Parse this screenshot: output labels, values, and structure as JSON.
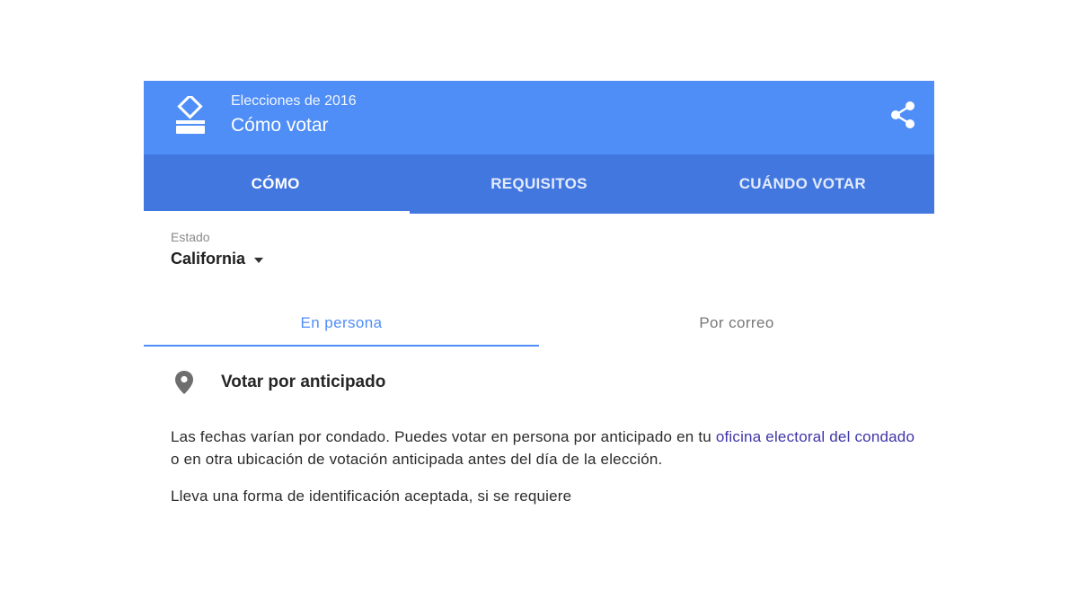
{
  "header": {
    "subtitle": "Elecciones de 2016",
    "title": "Cómo votar",
    "icon": "ballot-box-icon",
    "share_icon": "share-icon",
    "bg_color": "#4f8ef7"
  },
  "tabs": [
    {
      "label": "CÓMO",
      "active": true
    },
    {
      "label": "REQUISITOS",
      "active": false
    },
    {
      "label": "CUÁNDO VOTAR",
      "active": false
    }
  ],
  "state": {
    "label": "Estado",
    "value": "California"
  },
  "mode_tabs": [
    {
      "label": "En persona",
      "active": true
    },
    {
      "label": "Por correo",
      "active": false
    }
  ],
  "section": {
    "title": "Votar por anticipado",
    "icon": "location-pin-icon",
    "para1_before": "Las fechas varían por condado. Puedes votar en persona por anticipado en tu ",
    "para1_link": "oficina electoral del condado",
    "para1_after": " o en otra ubicación de votación anticipada antes del día de la elección.",
    "para2": "Lleva una forma de identificación aceptada, si se requiere"
  },
  "colors": {
    "header": "#4f8ef7",
    "tabs": "#4377e0",
    "link": "#3e35a8"
  }
}
